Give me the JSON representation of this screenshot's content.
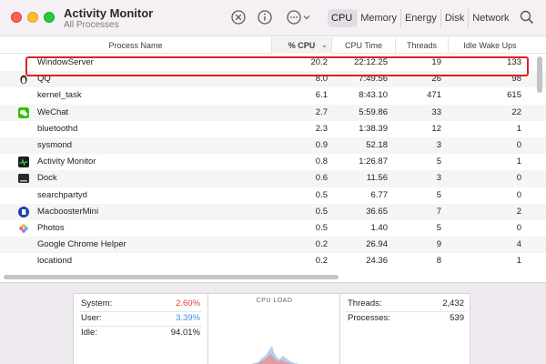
{
  "window": {
    "title": "Activity Monitor",
    "subtitle": "All Processes"
  },
  "toolbar": {
    "icons": [
      "stop-process-icon",
      "info-icon",
      "more-options-icon",
      "search-icon"
    ],
    "tabs": [
      {
        "label": "CPU",
        "active": true
      },
      {
        "label": "Memory",
        "active": false
      },
      {
        "label": "Energy",
        "active": false
      },
      {
        "label": "Disk",
        "active": false
      },
      {
        "label": "Network",
        "active": false
      }
    ]
  },
  "table": {
    "columns": {
      "name": "Process Name",
      "cpu": "% CPU",
      "cpu_time": "CPU Time",
      "threads": "Threads",
      "idle_wake_ups": "Idle Wake Ups"
    },
    "sort_indicator": "⌄",
    "rows": [
      {
        "name": "WindowServer",
        "icon": "",
        "cpu": "20.2",
        "cpu_time": "22:12.25",
        "threads": "19",
        "idle": "133",
        "selected": true
      },
      {
        "name": "QQ",
        "icon": "penguin-icon",
        "cpu": "8.0",
        "cpu_time": "7:49.56",
        "threads": "26",
        "idle": "98"
      },
      {
        "name": "kernel_task",
        "icon": "",
        "cpu": "6.1",
        "cpu_time": "8:43.10",
        "threads": "471",
        "idle": "615"
      },
      {
        "name": "WeChat",
        "icon": "wechat-icon",
        "cpu": "2.7",
        "cpu_time": "5:59.86",
        "threads": "33",
        "idle": "22"
      },
      {
        "name": "bluetoothd",
        "icon": "",
        "cpu": "2.3",
        "cpu_time": "1:38.39",
        "threads": "12",
        "idle": "1"
      },
      {
        "name": "sysmond",
        "icon": "",
        "cpu": "0.9",
        "cpu_time": "52.18",
        "threads": "3",
        "idle": "0"
      },
      {
        "name": "Activity Monitor",
        "icon": "activity-monitor-icon",
        "cpu": "0.8",
        "cpu_time": "1:26.87",
        "threads": "5",
        "idle": "1"
      },
      {
        "name": "Dock",
        "icon": "dock-icon",
        "cpu": "0.6",
        "cpu_time": "11.56",
        "threads": "3",
        "idle": "0"
      },
      {
        "name": "searchpartyd",
        "icon": "",
        "cpu": "0.5",
        "cpu_time": "6.77",
        "threads": "5",
        "idle": "0"
      },
      {
        "name": "MacboosterMini",
        "icon": "macbooster-icon",
        "cpu": "0.5",
        "cpu_time": "36.65",
        "threads": "7",
        "idle": "2"
      },
      {
        "name": "Photos",
        "icon": "photos-icon",
        "cpu": "0.5",
        "cpu_time": "1.40",
        "threads": "5",
        "idle": "0"
      },
      {
        "name": "Google Chrome Helper",
        "icon": "",
        "cpu": "0.2",
        "cpu_time": "26.94",
        "threads": "9",
        "idle": "4"
      },
      {
        "name": "locationd",
        "icon": "",
        "cpu": "0.2",
        "cpu_time": "24.36",
        "threads": "8",
        "idle": "1"
      }
    ]
  },
  "summary": {
    "system_label": "System:",
    "system_value": "2.60%",
    "user_label": "User:",
    "user_value": "3.39%",
    "idle_label": "Idle:",
    "idle_value": "94.01%",
    "cpu_load_title": "CPU LOAD",
    "threads_label": "Threads:",
    "threads_value": "2,432",
    "processes_label": "Processes:",
    "processes_value": "539",
    "colors": {
      "system": "#e0453e",
      "user": "#3d8ee8"
    }
  }
}
